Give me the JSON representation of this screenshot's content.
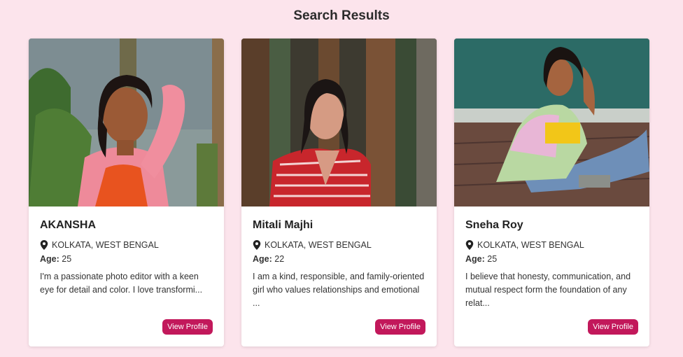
{
  "page": {
    "title": "Search Results"
  },
  "colors": {
    "background": "#fce4ec",
    "accent": "#c2185b"
  },
  "profiles": [
    {
      "name": "AKANSHA",
      "location": "KOLKATA, WEST BENGAL",
      "age_label": "Age:",
      "age": "25",
      "bio": "I'm a passionate photo editor with a keen eye for detail and color. I love transformi...",
      "button": "View Profile",
      "photo_icon": "profile-photo"
    },
    {
      "name": "Mitali Majhi",
      "location": "KOLKATA, WEST BENGAL",
      "age_label": "Age:",
      "age": "22",
      "bio": "I am a kind, responsible, and family-oriented girl who values relationships and emotional ...",
      "button": "View Profile",
      "photo_icon": "profile-photo"
    },
    {
      "name": "Sneha Roy",
      "location": "KOLKATA, WEST BENGAL",
      "age_label": "Age:",
      "age": "25",
      "bio": "I believe that honesty, communication, and mutual respect form the foundation of any relat...",
      "button": "View Profile",
      "photo_icon": "profile-photo"
    }
  ]
}
